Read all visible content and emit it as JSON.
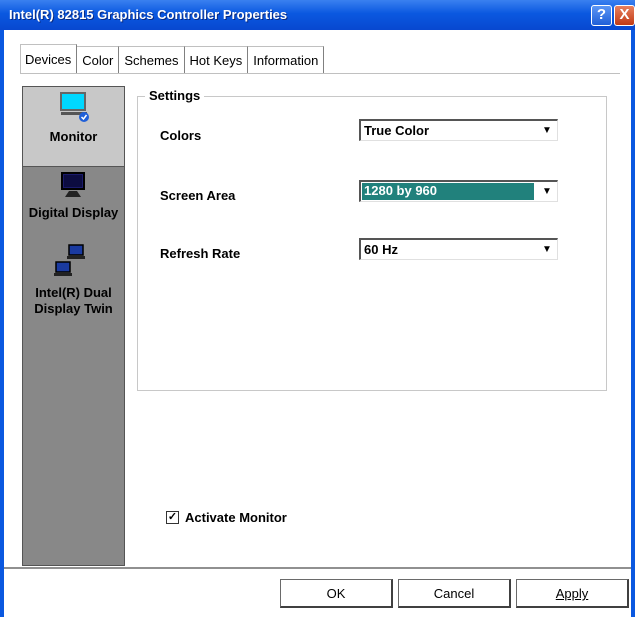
{
  "window": {
    "title": "Intel(R) 82815 Graphics Controller Properties",
    "help_label": "?",
    "close_label": "X"
  },
  "tabs": [
    {
      "label": "Devices",
      "active": true
    },
    {
      "label": "Color"
    },
    {
      "label": "Schemes"
    },
    {
      "label": "Hot Keys"
    },
    {
      "label": "Information"
    }
  ],
  "sidebar": {
    "items": [
      {
        "label": "Monitor",
        "icon": "monitor-icon",
        "active": true
      },
      {
        "label": "Digital Display",
        "icon": "digital-display-icon"
      },
      {
        "label": "Intel(R) Dual Display Twin",
        "icon": "dual-display-icon"
      }
    ]
  },
  "settings": {
    "group_label": "Settings",
    "colors": {
      "label": "Colors",
      "value": "True Color"
    },
    "screen_area": {
      "label": "Screen Area",
      "value": "1280 by 960"
    },
    "refresh_rate": {
      "label": "Refresh Rate",
      "value": "60 Hz"
    }
  },
  "activate": {
    "label": "Activate Monitor",
    "checked": true,
    "check_mark": "✓"
  },
  "buttons": {
    "ok": "OK",
    "cancel": "Cancel",
    "apply": "Apply"
  },
  "colors": {
    "title_bar": "#0a58e0",
    "selection": "#21817c",
    "sidebar": "#888888"
  }
}
